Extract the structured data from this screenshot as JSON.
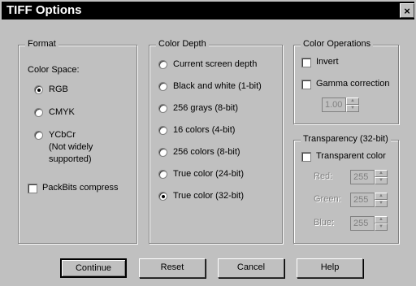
{
  "window": {
    "title": "TIFF Options",
    "close_glyph": "×"
  },
  "format": {
    "legend": "Format",
    "color_space_label": "Color Space:",
    "options": [
      {
        "label": "RGB",
        "selected": true
      },
      {
        "label": "CMYK",
        "selected": false
      },
      {
        "label": "YCbCr",
        "selected": false
      }
    ],
    "ycbcr_note_line1": "(Not widely",
    "ycbcr_note_line2": "supported)",
    "packbits_label": "PackBits compress",
    "packbits_checked": false
  },
  "color_depth": {
    "legend": "Color Depth",
    "options": [
      {
        "label": "Current screen depth",
        "selected": false
      },
      {
        "label": "Black and white (1-bit)",
        "selected": false
      },
      {
        "label": "256 grays (8-bit)",
        "selected": false
      },
      {
        "label": "16 colors (4-bit)",
        "selected": false
      },
      {
        "label": "256 colors (8-bit)",
        "selected": false
      },
      {
        "label": "True color (24-bit)",
        "selected": false
      },
      {
        "label": "True color (32-bit)",
        "selected": true
      }
    ]
  },
  "color_operations": {
    "legend": "Color Operations",
    "invert_label": "Invert",
    "invert_checked": false,
    "gamma_label": "Gamma correction",
    "gamma_checked": false,
    "gamma_value": "1.00"
  },
  "transparency": {
    "legend": "Transparency (32-bit)",
    "transparent_label": "Transparent color",
    "transparent_checked": false,
    "red_label": "Red:",
    "red_value": "255",
    "green_label": "Green:",
    "green_value": "255",
    "blue_label": "Blue:",
    "blue_value": "255"
  },
  "buttons": {
    "continue": "Continue",
    "reset": "Reset",
    "cancel": "Cancel",
    "help": "Help"
  },
  "colors": {
    "face": "#c0c0c0",
    "title_bg": "#000000",
    "disabled_text": "#808080"
  }
}
